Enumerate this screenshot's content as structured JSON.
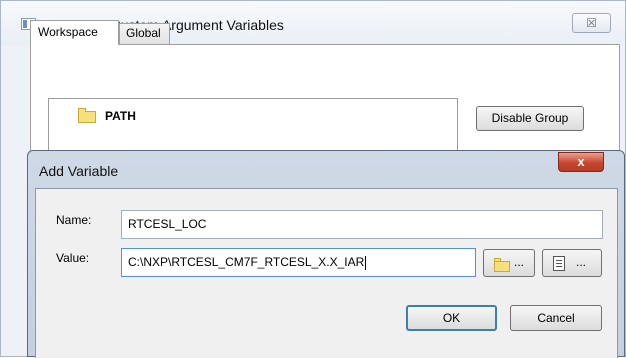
{
  "outer_dialog": {
    "title": "Configure Custom Argument Variables",
    "close_glyph": "☒",
    "tabs": [
      {
        "label": "Workspace",
        "selected": true
      },
      {
        "label": "Global",
        "selected": false
      }
    ],
    "tree": {
      "items": [
        {
          "label": "PATH",
          "icon": "folder-icon"
        }
      ]
    },
    "buttons": {
      "disable_group": "Disable Group"
    }
  },
  "add_variable_dialog": {
    "title": "Add Variable",
    "close_glyph": "x",
    "name_label": "Name:",
    "name_value": "RTCESL_LOC",
    "value_label": "Value:",
    "value_value": "C:\\NXP\\RTCESL_CM7F_RTCESL_X.X_IAR",
    "browse_folder_dots": "...",
    "browse_file_dots": "...",
    "ok_label": "OK",
    "cancel_label": "Cancel"
  },
  "colors": {
    "accent": "#3c7fb1",
    "close_red": "#c9462e",
    "folder_yellow": "#f6e07c"
  }
}
